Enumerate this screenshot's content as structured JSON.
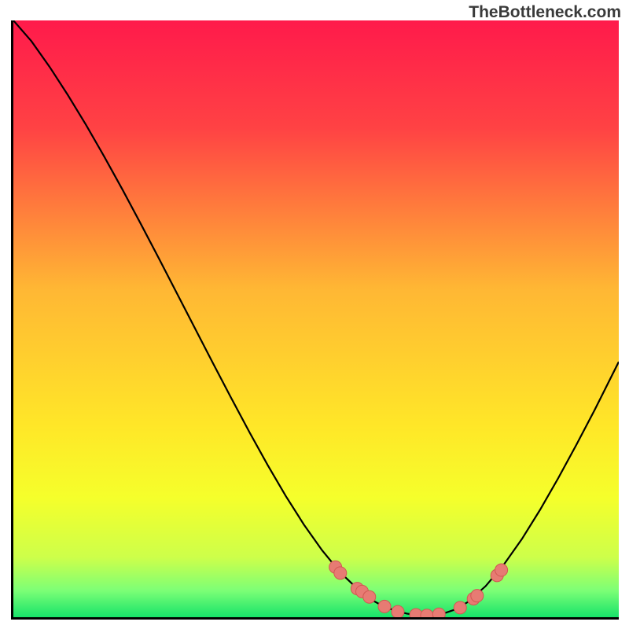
{
  "attribution": "TheBottleneck.com",
  "colors": {
    "gradient_stops": [
      {
        "offset": 0.0,
        "color": "#ff1a4b"
      },
      {
        "offset": 0.18,
        "color": "#ff4244"
      },
      {
        "offset": 0.45,
        "color": "#ffb734"
      },
      {
        "offset": 0.68,
        "color": "#ffe728"
      },
      {
        "offset": 0.8,
        "color": "#f5ff2b"
      },
      {
        "offset": 0.9,
        "color": "#cdff4a"
      },
      {
        "offset": 0.955,
        "color": "#7dff76"
      },
      {
        "offset": 1.0,
        "color": "#17e36a"
      }
    ],
    "curve": "#000000",
    "marker_fill": "#e77b73",
    "marker_stroke": "#d15852"
  },
  "chart_data": {
    "type": "line",
    "title": "",
    "xlabel": "",
    "ylabel": "",
    "xlim": [
      0,
      100
    ],
    "ylim": [
      0,
      100
    ],
    "grid": false,
    "legend": false,
    "series": [
      {
        "name": "bottleneck-curve",
        "x": [
          0,
          3,
          6,
          9,
          12,
          15,
          18,
          21,
          24,
          27,
          30,
          33,
          36,
          39,
          42,
          45,
          48,
          51,
          54,
          57,
          59,
          61,
          63,
          65,
          67,
          69,
          71,
          73,
          75,
          78,
          81,
          84,
          87,
          90,
          93,
          96,
          100
        ],
        "y": [
          100,
          96.5,
          92.2,
          87.5,
          82.5,
          77.2,
          71.7,
          66.0,
          60.2,
          54.3,
          48.4,
          42.5,
          36.7,
          31.0,
          25.5,
          20.3,
          15.5,
          11.2,
          7.5,
          4.6,
          3.0,
          1.9,
          1.1,
          0.6,
          0.3,
          0.3,
          0.6,
          1.3,
          2.5,
          5.2,
          8.8,
          13.1,
          18.0,
          23.3,
          28.9,
          34.7,
          42.8
        ]
      }
    ],
    "markers": {
      "name": "highlighted-points",
      "x": [
        53.2,
        54.0,
        56.8,
        57.6,
        58.8,
        61.3,
        63.5,
        66.5,
        68.3,
        70.3,
        73.8,
        76.0,
        76.6,
        79.9,
        80.6
      ],
      "y": [
        8.4,
        7.4,
        4.8,
        4.3,
        3.4,
        1.8,
        0.9,
        0.4,
        0.3,
        0.5,
        1.6,
        3.1,
        3.6,
        7.0,
        7.9
      ]
    }
  }
}
